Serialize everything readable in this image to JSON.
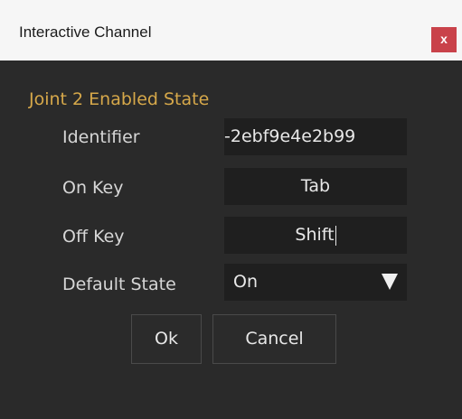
{
  "window": {
    "title": "Interactive Channel",
    "close_label": "x"
  },
  "form": {
    "heading": "Joint 2 Enabled State",
    "identifier": {
      "label": "Identifier",
      "value": "-2ebf9e4e2b99"
    },
    "on_key": {
      "label": "On Key",
      "value": "Tab"
    },
    "off_key": {
      "label": "Off Key",
      "value": "Shift"
    },
    "default_state": {
      "label": "Default State",
      "value": "On"
    }
  },
  "buttons": {
    "ok": "Ok",
    "cancel": "Cancel"
  },
  "colors": {
    "heading_accent": "#d6a84a",
    "close_button": "#c9424a",
    "background": "#2a2a2a",
    "field_bg": "#1f1f1f"
  },
  "icons": {
    "close": "close-icon",
    "dropdown": "triangle-down-icon"
  }
}
